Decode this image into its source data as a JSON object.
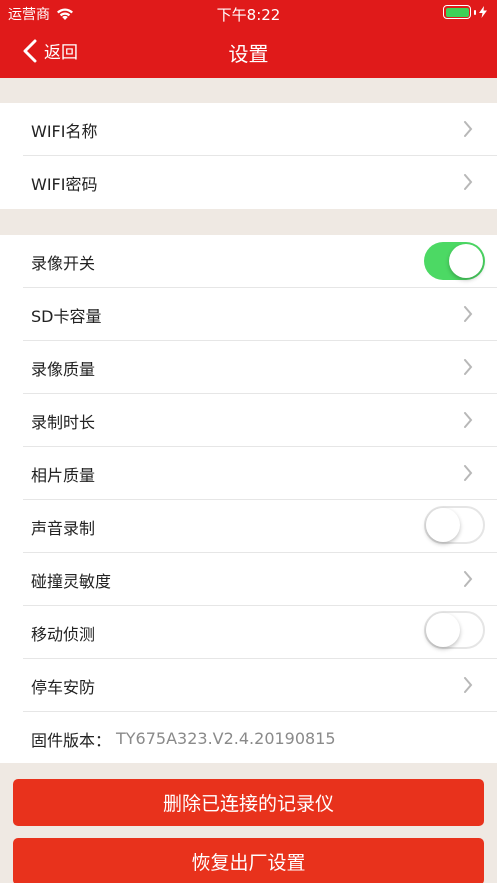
{
  "status_bar": {
    "carrier": "运营商",
    "time": "下午8:22"
  },
  "nav": {
    "back_label": "返回",
    "title": "设置"
  },
  "wifi_group": [
    {
      "label": "WIFI名称"
    },
    {
      "label": "WIFI密码"
    }
  ],
  "settings_group": [
    {
      "label": "录像开关",
      "control": "toggle",
      "on": true
    },
    {
      "label": "SD卡容量",
      "control": "chevron"
    },
    {
      "label": "录像质量",
      "control": "chevron"
    },
    {
      "label": "录制时长",
      "control": "chevron"
    },
    {
      "label": "相片质量",
      "control": "chevron"
    },
    {
      "label": "声音录制",
      "control": "toggle",
      "on": false
    },
    {
      "label": "碰撞灵敏度",
      "control": "chevron"
    },
    {
      "label": "移动侦测",
      "control": "toggle",
      "on": false
    },
    {
      "label": "停车安防",
      "control": "chevron"
    }
  ],
  "firmware": {
    "label": "固件版本：",
    "value": "TY675A323.V2.4.20190815"
  },
  "buttons": {
    "delete_label": "删除已连接的记录仪",
    "reset_label": "恢复出厂设置"
  },
  "colors": {
    "header": "#e01a1a",
    "button": "#e8321c",
    "toggle_on": "#4cd964",
    "background": "#efe9e3"
  }
}
